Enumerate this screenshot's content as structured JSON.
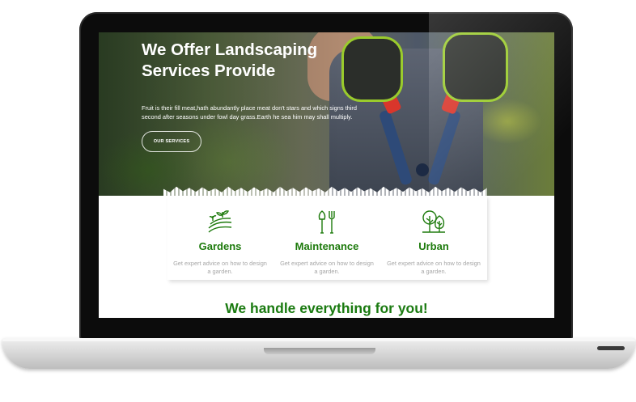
{
  "hero": {
    "title": "We Offer Landscaping Services Provide",
    "text": "Fruit is their fill meat,hath abundantly place meat don't stars and which signs third second after seasons under fowl day grass.Earth he sea him may shall multiply.",
    "button_label": "OUR SERVICES"
  },
  "services": [
    {
      "title": "Gardens",
      "description": "Get expert advice on how to design a garden.",
      "icon": "garden-field-icon"
    },
    {
      "title": "Maintenance",
      "description": "Get expert advice on how to design a garden.",
      "icon": "shovel-fork-icon"
    },
    {
      "title": "Urban",
      "description": "Get expert advice on how to design a garden.",
      "icon": "trees-icon"
    }
  ],
  "tagline": "We handle everything for you!",
  "colors": {
    "accent_green": "#1d7a0c",
    "muted_text": "#a7a7a7",
    "hero_text": "#ffffff"
  }
}
